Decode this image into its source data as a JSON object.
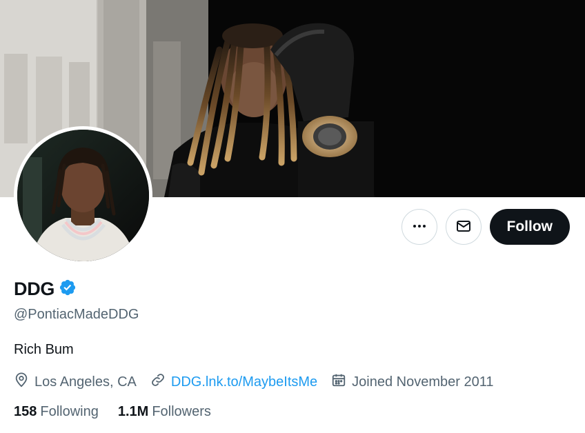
{
  "profile": {
    "display_name": "DDG",
    "verified": true,
    "handle": "@PontiacMadeDDG",
    "bio": "Rich Bum",
    "location": "Los Angeles, CA",
    "website": "DDG.lnk.to/MaybeItsMe",
    "joined": "Joined November 2011"
  },
  "stats": {
    "following_count": "158",
    "following_label": "Following",
    "followers_count": "1.1M",
    "followers_label": "Followers"
  },
  "actions": {
    "more_icon": "more-horizontal-icon",
    "message_icon": "envelope-icon",
    "follow_label": "Follow"
  },
  "colors": {
    "accent": "#1d9bf0",
    "text_primary": "#0f1419",
    "text_secondary": "#536471",
    "follow_button": "#0f1419"
  }
}
